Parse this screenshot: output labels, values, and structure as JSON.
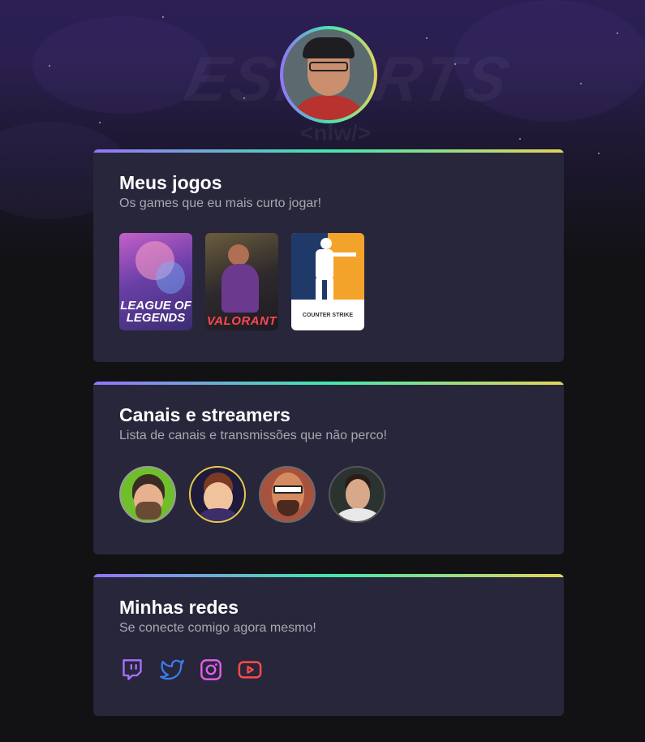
{
  "profile": {
    "avatar_alt": "Profile picture"
  },
  "background": {
    "watermark": "ESPORTS",
    "watermark_sub": "<nlw/>"
  },
  "sections": {
    "games": {
      "title": "Meus jogos",
      "subtitle": "Os games que eu mais curto jogar!",
      "items": [
        {
          "name": "League of Legends",
          "label": "LEAGUE OF LEGENDS"
        },
        {
          "name": "Valorant",
          "label": "VALORANT"
        },
        {
          "name": "Counter-Strike",
          "label": "COUNTER STRIKE"
        }
      ]
    },
    "streams": {
      "title": "Canais e streamers",
      "subtitle": "Lista de canais e transmissões que não perco!",
      "items": [
        {
          "name": "streamer-1"
        },
        {
          "name": "streamer-2"
        },
        {
          "name": "streamer-3"
        },
        {
          "name": "streamer-4"
        }
      ]
    },
    "social": {
      "title": "Minhas redes",
      "subtitle": "Se conecte comigo agora mesmo!",
      "items": [
        {
          "icon": "twitch-icon",
          "color": "#a970ff"
        },
        {
          "icon": "twitter-icon",
          "color": "#3d7cf0"
        },
        {
          "icon": "instagram-icon",
          "color": "#e45ff0"
        },
        {
          "icon": "youtube-icon",
          "color": "#ff4a4a"
        }
      ]
    }
  },
  "colors": {
    "background": "#121214",
    "card": "#28263a",
    "gradient_start": "#9572fc",
    "gradient_mid": "#43e7ad",
    "gradient_end": "#e2d45c",
    "title_text": "#ffffff",
    "subtitle_text": "#a8a8b3"
  }
}
